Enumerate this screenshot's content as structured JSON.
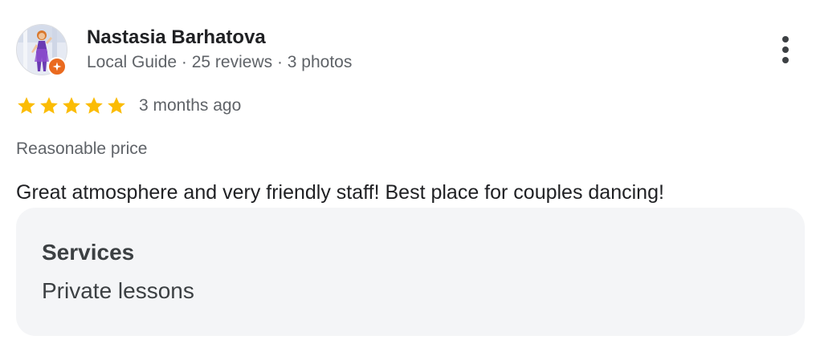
{
  "review": {
    "author": {
      "name": "Nastasia Barhatova",
      "meta": "Local Guide · 25 reviews · 3 photos",
      "badge_icon": "local-guide-star-icon"
    },
    "rating": {
      "stars": 5,
      "max_stars": 5,
      "star_color": "#fbbc04"
    },
    "date": "3 months ago",
    "attribute": "Reasonable price",
    "text": "Great atmosphere and very friendly staff! Best place for couples dancing!",
    "services": {
      "heading": "Services",
      "value": "Private lessons"
    },
    "more_icon": "more-vert-icon"
  },
  "colors": {
    "badge": "#ea6a1f",
    "card_background": "#f4f5f7",
    "secondary_text": "#5f6368",
    "primary_text": "#202124"
  }
}
